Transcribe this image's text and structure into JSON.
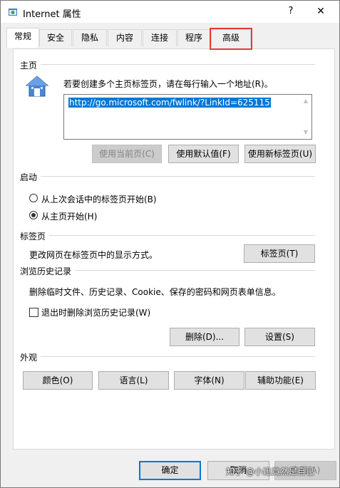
{
  "window": {
    "title": "Internet 属性",
    "help": "?",
    "close": "✕"
  },
  "tabs": [
    "常规",
    "安全",
    "隐私",
    "内容",
    "连接",
    "程序",
    "高级"
  ],
  "home": {
    "section": "主页",
    "instruction": "若要创建多个主页标签页，请在每行输入一个地址(R)。",
    "url": "http://go.microsoft.com/fwlink/?LinkId=625115",
    "use_current": "使用当前页(C)",
    "use_default": "使用默认值(F)",
    "use_new_tab": "使用新标签页(U)"
  },
  "startup": {
    "section": "启动",
    "option_last_session": "从上次会话中的标签页开始(B)",
    "option_home": "从主页开始(H)",
    "selected": "option_home"
  },
  "tabs_section": {
    "section": "标签页",
    "description": "更改网页在标签页中的显示方式。",
    "button": "标签页(T)"
  },
  "history": {
    "section": "浏览历史记录",
    "description": "删除临时文件、历史记录、Cookie、保存的密码和网页表单信息。",
    "delete_on_exit": "退出时删除浏览历史记录(W)",
    "delete_btn": "删除(D)...",
    "settings_btn": "设置(S)"
  },
  "appearance": {
    "section": "外观",
    "colors": "颜色(O)",
    "languages": "语言(L)",
    "fonts": "字体(N)",
    "accessibility": "辅助功能(E)"
  },
  "footer": {
    "ok": "确定",
    "cancel": "取消",
    "apply": "应用(A)"
  },
  "watermark": "知乎 @小迅竟然是自己",
  "colors": {
    "accent": "#0078d7",
    "highlight_box": "#e43b3b"
  }
}
